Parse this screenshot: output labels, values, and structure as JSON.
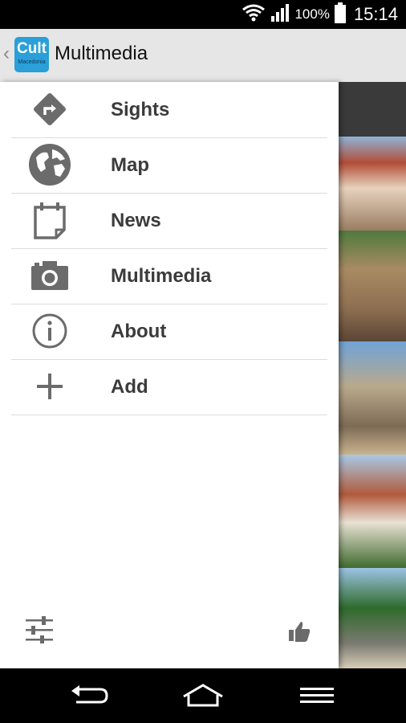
{
  "status_bar": {
    "battery": "100%",
    "time": "15:14"
  },
  "action_bar": {
    "logo_text": "Cult",
    "logo_subtext": "Macedonia",
    "title": "Multimedia"
  },
  "drawer": {
    "items": [
      {
        "label": "Sights",
        "icon": "directions-icon"
      },
      {
        "label": "Map",
        "icon": "globe-icon"
      },
      {
        "label": "News",
        "icon": "calendar-icon"
      },
      {
        "label": "Multimedia",
        "icon": "camera-icon"
      },
      {
        "label": "About",
        "icon": "info-icon"
      },
      {
        "label": "Add",
        "icon": "plus-icon"
      }
    ],
    "footer": {
      "left_icon": "settings-sliders-icon",
      "right_icon": "thumbs-up-icon"
    }
  },
  "nav_bar": {
    "buttons": [
      "back-icon",
      "home-icon",
      "menu-icon"
    ]
  },
  "colors": {
    "logo": "#2a9fd8",
    "action_bar": "#e6e6e6",
    "icon_gray": "#6b6b6b"
  }
}
